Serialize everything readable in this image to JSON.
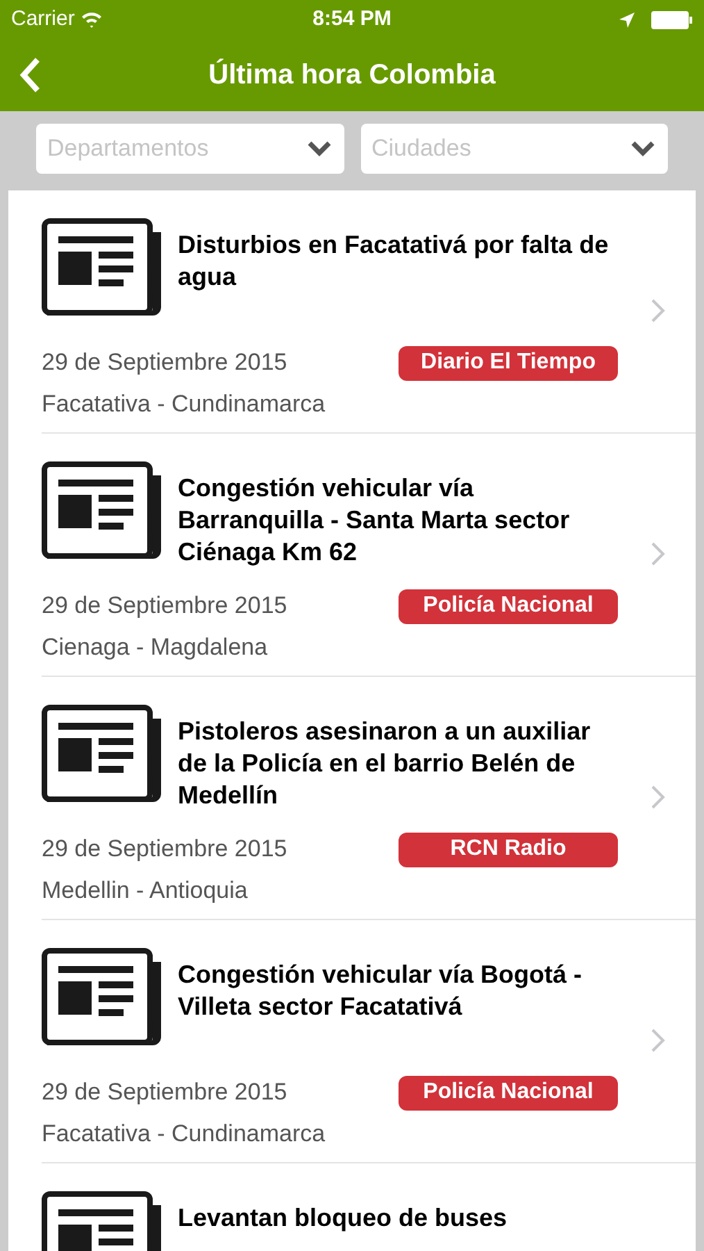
{
  "status_bar": {
    "carrier": "Carrier",
    "time": "8:54 PM"
  },
  "nav": {
    "title": "Última hora Colombia"
  },
  "filters": [
    {
      "placeholder": "Departamentos"
    },
    {
      "placeholder": "Ciudades"
    }
  ],
  "news": [
    {
      "title": "Disturbios en Facatativá por falta de agua",
      "date": "29 de Septiembre 2015",
      "source": "Diario El Tiempo",
      "location": "Facatativa - Cundinamarca"
    },
    {
      "title": "Congestión vehicular vía Barranquilla - Santa Marta sector Ciénaga Km 62",
      "date": "29 de Septiembre 2015",
      "source": "Policía Nacional",
      "location": "Cienaga - Magdalena"
    },
    {
      "title": "Pistoleros asesinaron a un auxiliar de la Policía en el barrio Belén de Medellín",
      "date": "29 de Septiembre 2015",
      "source": "RCN Radio",
      "location": "Medellin - Antioquia"
    },
    {
      "title": "Congestión vehicular vía Bogotá - Villeta sector Facatativá",
      "date": "29 de Septiembre 2015",
      "source": "Policía Nacional",
      "location": "Facatativa - Cundinamarca"
    },
    {
      "title": "Levantan bloqueo de buses"
    }
  ]
}
